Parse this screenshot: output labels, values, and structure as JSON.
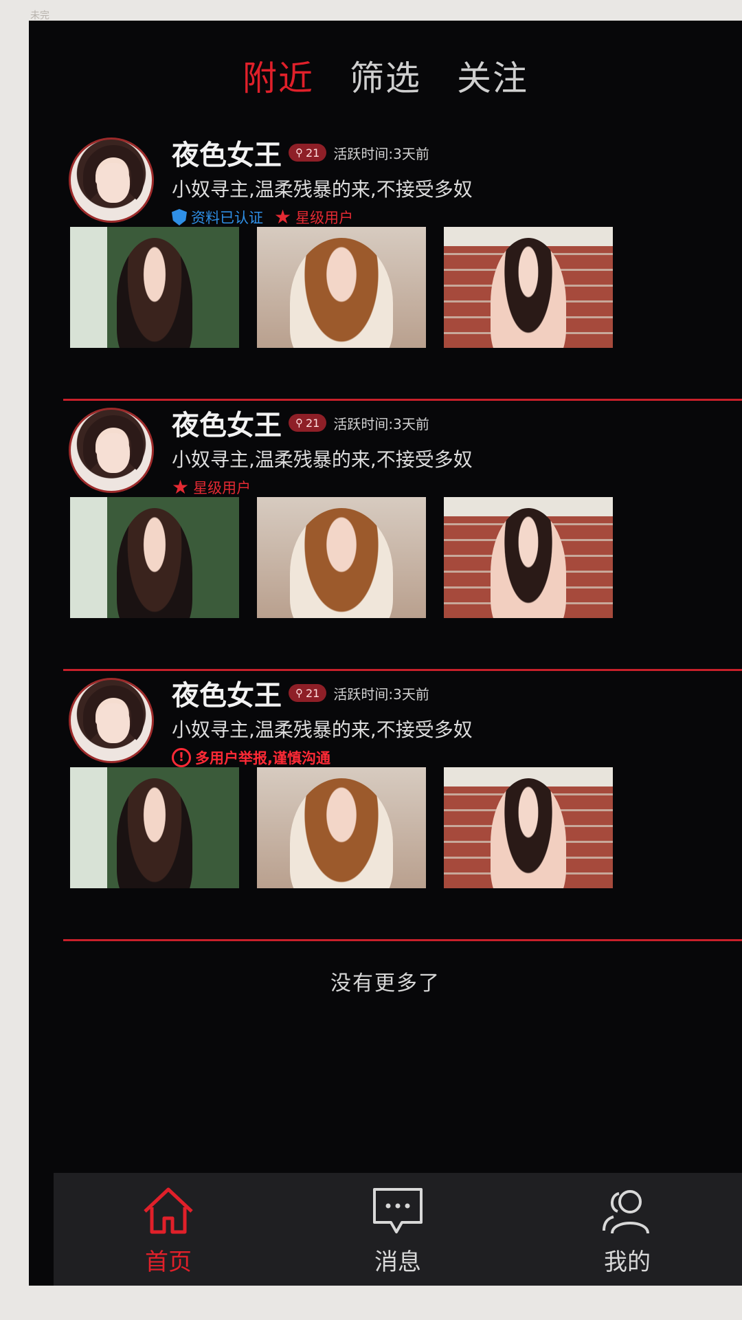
{
  "corner_text": "未完",
  "tabs": [
    {
      "label": "附近",
      "active": true
    },
    {
      "label": "筛选",
      "active": false
    },
    {
      "label": "关注",
      "active": false
    }
  ],
  "cards": [
    {
      "name": "夜色女王",
      "badge_age": "21",
      "active_time": "活跃时间:3天前",
      "bio": "小奴寻主,温柔残暴的来,不接受多奴",
      "tags": [
        {
          "type": "verified",
          "icon": "shield-icon",
          "label": "资料已认证"
        },
        {
          "type": "star",
          "icon": "star-icon",
          "label": "星级用户"
        }
      ]
    },
    {
      "name": "夜色女王",
      "badge_age": "21",
      "active_time": "活跃时间:3天前",
      "bio": "小奴寻主,温柔残暴的来,不接受多奴",
      "tags": [
        {
          "type": "star",
          "icon": "star-icon",
          "label": "星级用户"
        }
      ]
    },
    {
      "name": "夜色女王",
      "badge_age": "21",
      "active_time": "活跃时间:3天前",
      "bio": "小奴寻主,温柔残暴的来,不接受多奴",
      "tags": [
        {
          "type": "warn",
          "icon": "warning-icon",
          "label": "多用户举报,谨慎沟通"
        }
      ]
    }
  ],
  "footer_text": "没有更多了",
  "bottom_nav": [
    {
      "label": "首页",
      "icon": "home-icon",
      "active": true
    },
    {
      "label": "消息",
      "icon": "message-icon",
      "active": false
    },
    {
      "label": "我的",
      "icon": "users-icon",
      "active": false
    }
  ],
  "colors": {
    "accent": "#e0202a",
    "background": "#070709",
    "verified": "#2f8fe6",
    "nav_bg": "#1f1f22"
  }
}
